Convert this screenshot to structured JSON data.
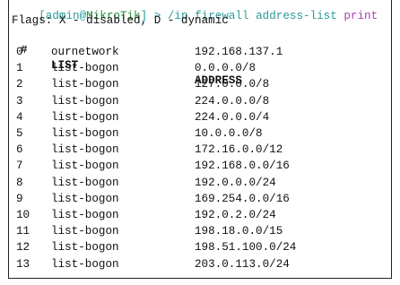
{
  "prompt": {
    "open_bracket": "[",
    "user": "admin",
    "at": "@",
    "host": "MikroTik",
    "close": "] > ",
    "command": "/ip firewall address-list ",
    "command_last": "print"
  },
  "flags_line": "Flags: X - disabled, D - dynamic",
  "columns": {
    "num": "#",
    "list": "LIST",
    "address": "ADDRESS"
  },
  "rows": [
    {
      "num": "0",
      "list": "ournetwork",
      "address": "192.168.137.1"
    },
    {
      "num": "1",
      "list": "list-bogon",
      "address": "0.0.0.0/8"
    },
    {
      "num": "2",
      "list": "list-bogon",
      "address": "127.0.0.0/8"
    },
    {
      "num": "3",
      "list": "list-bogon",
      "address": "224.0.0.0/8"
    },
    {
      "num": "4",
      "list": "list-bogon",
      "address": "224.0.0.0/4"
    },
    {
      "num": "5",
      "list": "list-bogon",
      "address": "10.0.0.0/8"
    },
    {
      "num": "6",
      "list": "list-bogon",
      "address": "172.16.0.0/12"
    },
    {
      "num": "7",
      "list": "list-bogon",
      "address": "192.168.0.0/16"
    },
    {
      "num": "8",
      "list": "list-bogon",
      "address": "192.0.0.0/24"
    },
    {
      "num": "9",
      "list": "list-bogon",
      "address": "169.254.0.0/16"
    },
    {
      "num": "10",
      "list": "list-bogon",
      "address": "192.0.2.0/24"
    },
    {
      "num": "11",
      "list": "list-bogon",
      "address": "198.18.0.0/15"
    },
    {
      "num": "12",
      "list": "list-bogon",
      "address": "198.51.100.0/24"
    },
    {
      "num": "13",
      "list": "list-bogon",
      "address": "203.0.113.0/24"
    }
  ]
}
